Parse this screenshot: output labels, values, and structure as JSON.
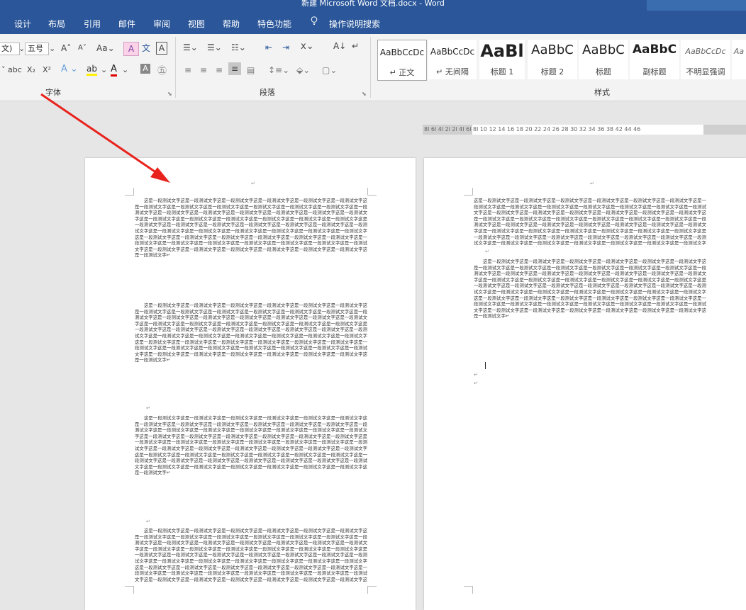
{
  "window": {
    "title": "新建 Microsoft Word 文档.docx  -  Word"
  },
  "tabs": [
    "设计",
    "布局",
    "引用",
    "邮件",
    "审阅",
    "视图",
    "帮助",
    "特色功能"
  ],
  "search_label": "操作说明搜索",
  "font": {
    "name_value": "文)",
    "size_value": "五号",
    "group_label": "字体"
  },
  "paragraph": {
    "group_label": "段落"
  },
  "styles": {
    "group_label": "样式",
    "items": [
      {
        "sample": "AaBbCcDc",
        "name": "↵ 正文",
        "selected": true
      },
      {
        "sample": "AaBbCcDc",
        "name": "↵ 无间隔"
      },
      {
        "sample": "AaBl",
        "name": "标题 1"
      },
      {
        "sample": "AaBbC",
        "name": "标题 2"
      },
      {
        "sample": "AaBbC",
        "name": "标题"
      },
      {
        "sample": "AaBbC",
        "name": "副标题"
      },
      {
        "sample": "AaBbCcDc",
        "name": "不明显强调"
      },
      {
        "sample": "Aa",
        "name": ""
      }
    ]
  },
  "ruler": {
    "text": "8l 6l 4l 2l   2l 4l 6l 8l 10 12 14 16 18 20 22 24 26 28 30 32 34 36 38   42 44 46"
  },
  "document": {
    "paragraph_text": "这是一段测试文字这是一段测试文字这是一段测试文字这是一段测试文字这是一段测试文字这是一段测试文字这是一段测试文字这是一段测试文字这是一段测试文字这是一段测试文字这是一段测试文字这是一段测试文字这是一段测试文字这是一段测试文字这是一段测试文字这是一段测试文字这是一段测试文字这是一段测试文字这是一段测试文字这是一段测试文字这是一段测试文字这是一段测试文字这是一段测试文字这是一段测试文字这是一段测试文字这是一段测试文字这是一段测试文字这是一段测试文字这是一段测试文字这是一段测试文字这是一段测试文字这是一段测试文字这是一段测试文字这是一段测试文字这是一段测试文字这是一段测试文字这是一段测试文字这是一段测试文字这是一段测试文字这是一段测试文字这是一段测试文字这是一段测试文字这是一段测试文字这是一段测试文字这是一段测试文字这是一段测试文字这是一段测试文字这是一段测试文字这是一段测试文字这是一段测试文字这是一段测试文字这是一段测试文字这是一段测试文字这是一段测试文字这是一段测试文字这是一段测试文字这是一段测试文字这是一段测试文字↵",
    "paragraph_mark": "↵"
  }
}
